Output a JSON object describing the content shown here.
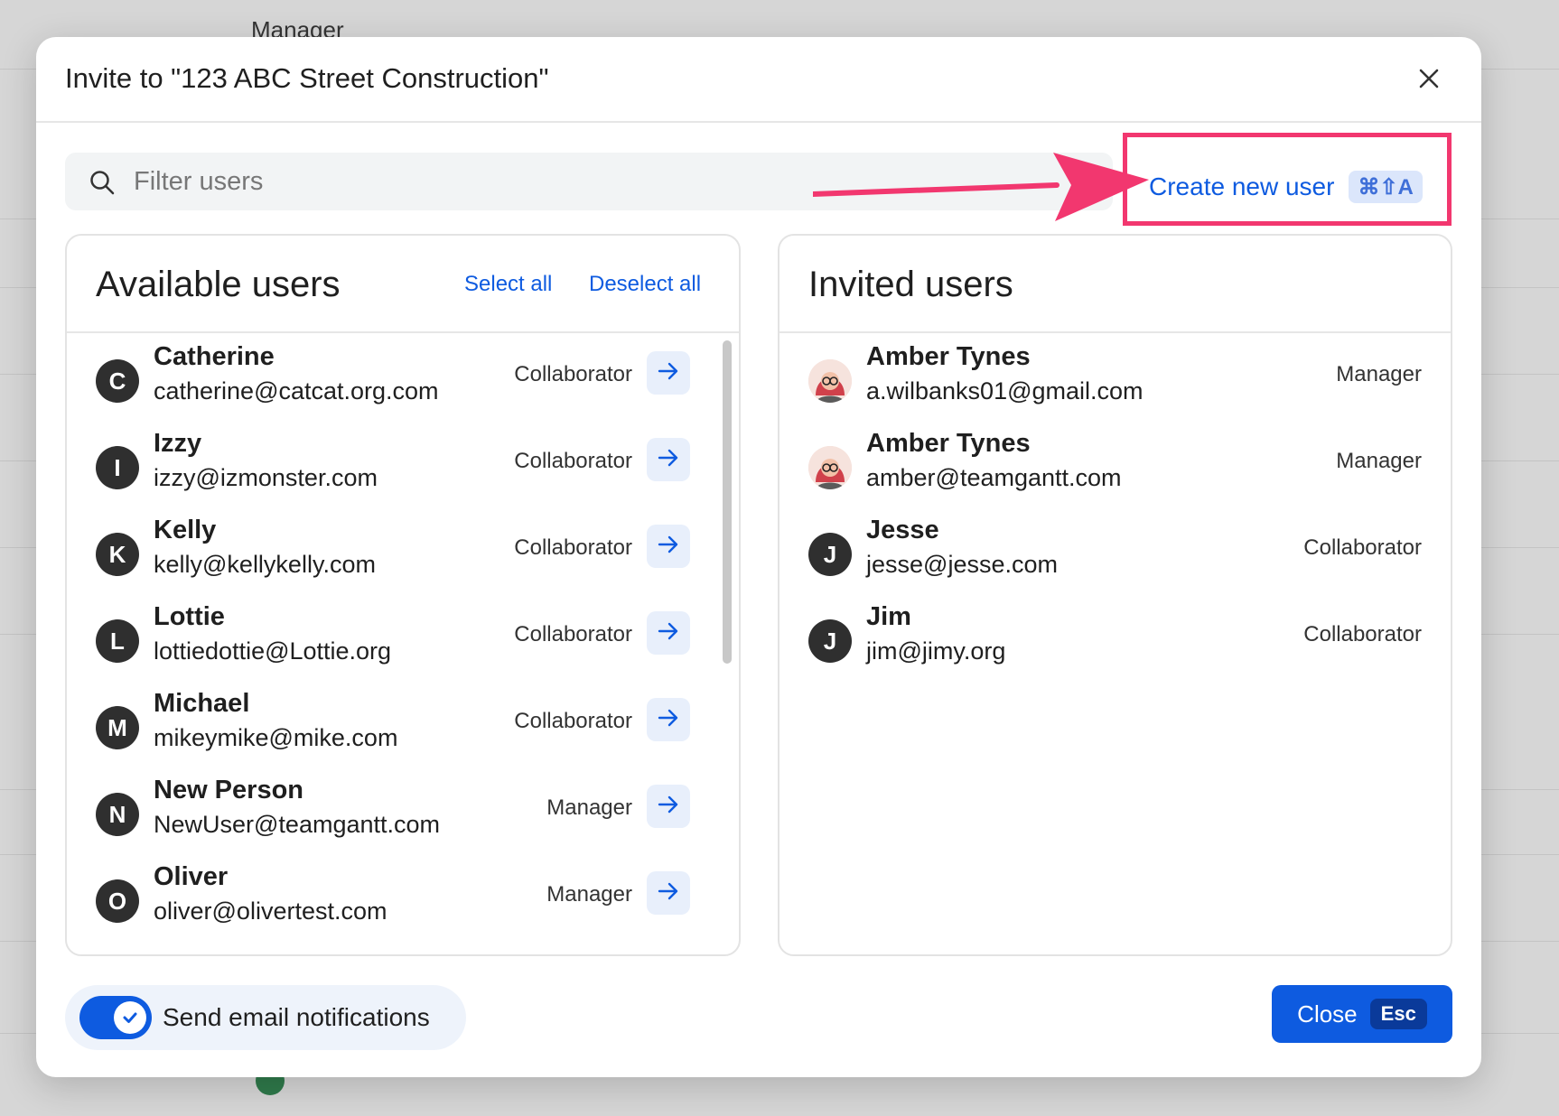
{
  "background": {
    "partial_text": "Manager"
  },
  "modal": {
    "title": "Invite to \"123 ABC Street Construction\"",
    "close_icon": "close-icon"
  },
  "search": {
    "placeholder": "Filter users",
    "value": ""
  },
  "create_user": {
    "label": "Create new user",
    "shortcut": "⌘⇧A"
  },
  "available": {
    "title": "Available users",
    "select_all": "Select all",
    "deselect_all": "Deselect all",
    "users": [
      {
        "initial": "C",
        "name": "Catherine",
        "email": "catherine@catcat.org.com",
        "role": "Collaborator"
      },
      {
        "initial": "I",
        "name": "Izzy",
        "email": "izzy@izmonster.com",
        "role": "Collaborator"
      },
      {
        "initial": "K",
        "name": "Kelly",
        "email": "kelly@kellykelly.com",
        "role": "Collaborator"
      },
      {
        "initial": "L",
        "name": "Lottie",
        "email": "lottiedottie@Lottie.org",
        "role": "Collaborator"
      },
      {
        "initial": "M",
        "name": "Michael",
        "email": "mikeymike@mike.com",
        "role": "Collaborator"
      },
      {
        "initial": "N",
        "name": "New Person",
        "email": "NewUser@teamgantt.com",
        "role": "Manager"
      },
      {
        "initial": "O",
        "name": "Oliver",
        "email": "oliver@olivertest.com",
        "role": "Manager"
      }
    ]
  },
  "invited": {
    "title": "Invited users",
    "users": [
      {
        "initial": "",
        "photo": true,
        "name": "Amber Tynes",
        "email": "a.wilbanks01@gmail.com",
        "role": "Manager"
      },
      {
        "initial": "",
        "photo": true,
        "name": "Amber Tynes",
        "email": "amber@teamgantt.com",
        "role": "Manager"
      },
      {
        "initial": "J",
        "photo": false,
        "name": "Jesse",
        "email": "jesse@jesse.com",
        "role": "Collaborator"
      },
      {
        "initial": "J",
        "photo": false,
        "name": "Jim",
        "email": "jim@jimy.org",
        "role": "Collaborator"
      }
    ]
  },
  "footer": {
    "notifications_label": "Send email notifications",
    "notifications_enabled": true,
    "close_label": "Close",
    "close_shortcut": "Esc"
  },
  "colors": {
    "accent": "#0e5be0",
    "annotation": "#f2376f"
  }
}
